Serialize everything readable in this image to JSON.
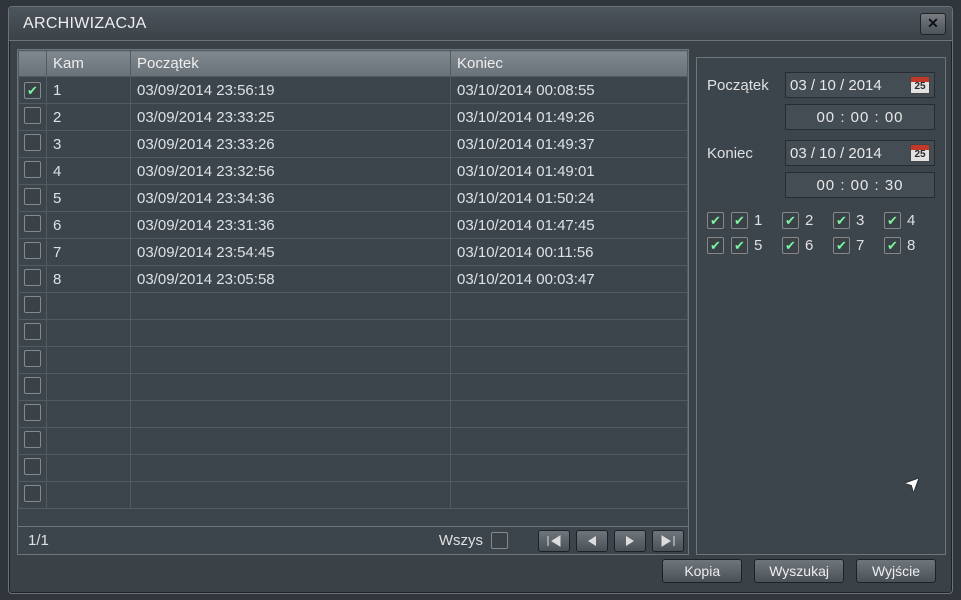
{
  "window": {
    "title": "ARCHIWIZACJA"
  },
  "table": {
    "headers": {
      "kam": "Kam",
      "start": "Początek",
      "end": "Koniec"
    },
    "rows": [
      {
        "checked": true,
        "kam": "1",
        "start": "03/09/2014 23:56:19",
        "end": "03/10/2014 00:08:55"
      },
      {
        "checked": false,
        "kam": "2",
        "start": "03/09/2014 23:33:25",
        "end": "03/10/2014 01:49:26"
      },
      {
        "checked": false,
        "kam": "3",
        "start": "03/09/2014 23:33:26",
        "end": "03/10/2014 01:49:37"
      },
      {
        "checked": false,
        "kam": "4",
        "start": "03/09/2014 23:32:56",
        "end": "03/10/2014 01:49:01"
      },
      {
        "checked": false,
        "kam": "5",
        "start": "03/09/2014 23:34:36",
        "end": "03/10/2014 01:50:24"
      },
      {
        "checked": false,
        "kam": "6",
        "start": "03/09/2014 23:31:36",
        "end": "03/10/2014 01:47:45"
      },
      {
        "checked": false,
        "kam": "7",
        "start": "03/09/2014 23:54:45",
        "end": "03/10/2014 00:11:56"
      },
      {
        "checked": false,
        "kam": "8",
        "start": "03/09/2014 23:05:58",
        "end": "03/10/2014 00:03:47"
      }
    ],
    "blank_rows": 8,
    "footer": {
      "page": "1/1",
      "all_label": "Wszys",
      "all_checked": false
    }
  },
  "side": {
    "start_label": "Początek",
    "end_label": "Koniec",
    "start_date": "03 / 10 / 2014",
    "start_time": "00  :  00  :  00",
    "end_date": "03 / 10 / 2014",
    "end_time": "00  :  00  :  30",
    "cal_text": "25",
    "master_checked": [
      true,
      true
    ],
    "channels": [
      {
        "label": "1",
        "checked": true
      },
      {
        "label": "2",
        "checked": true
      },
      {
        "label": "3",
        "checked": true
      },
      {
        "label": "4",
        "checked": true
      },
      {
        "label": "5",
        "checked": true
      },
      {
        "label": "6",
        "checked": true
      },
      {
        "label": "7",
        "checked": true
      },
      {
        "label": "8",
        "checked": true
      }
    ]
  },
  "buttons": {
    "copy": "Kopia",
    "search": "Wyszukaj",
    "exit": "Wyjście"
  }
}
